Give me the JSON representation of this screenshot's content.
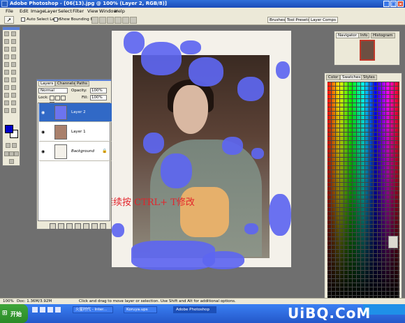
{
  "window": {
    "title": "Adobe Photoshop - [06(13).jpg @ 100% (Layer 2, RGB/8)]"
  },
  "menu": [
    "File",
    "Edit",
    "Image",
    "Layer",
    "Select",
    "Filter",
    "View",
    "Window",
    "Help"
  ],
  "options": {
    "auto_select": "Auto Select Layer",
    "bounding_box": "Show Bounding Box",
    "tabs": [
      "Brushes",
      "Tool Presets",
      "Layer Comps"
    ]
  },
  "layers_panel": {
    "tabs": [
      "Layers",
      "Channels",
      "Paths"
    ],
    "blend_mode": "Normal",
    "opacity_label": "Opacity:",
    "opacity_value": "100%",
    "lock_label": "Lock:",
    "fill_label": "Fill:",
    "fill_value": "100%",
    "layers": [
      {
        "name": "Layer 2"
      },
      {
        "name": "Layer 1"
      },
      {
        "name": "Background"
      }
    ]
  },
  "navigator_panel": {
    "tabs": [
      "Navigator",
      "Info",
      "Histogram"
    ]
  },
  "swatches_panel": {
    "tabs": [
      "Color",
      "Swatches",
      "Styles"
    ]
  },
  "canvas_caption": "如形状不满意可继续按 CTRL+ T修改",
  "status": {
    "zoom": "100%",
    "doc": "Doc: 1.36M/3.92M",
    "hint": "Click and drag to move layer or selection. Use Shift and Alt for additional options."
  },
  "taskbar": {
    "start_label": "开始",
    "buttons": [
      "火星时代 - Inter...",
      "Koruya.ups",
      "Adobe Photoshop"
    ]
  },
  "watermark": "UiBQ.CoM",
  "colors": {
    "foreground": "#0000c8",
    "background": "#ffffff",
    "paint_blue": "#5d66f0"
  }
}
